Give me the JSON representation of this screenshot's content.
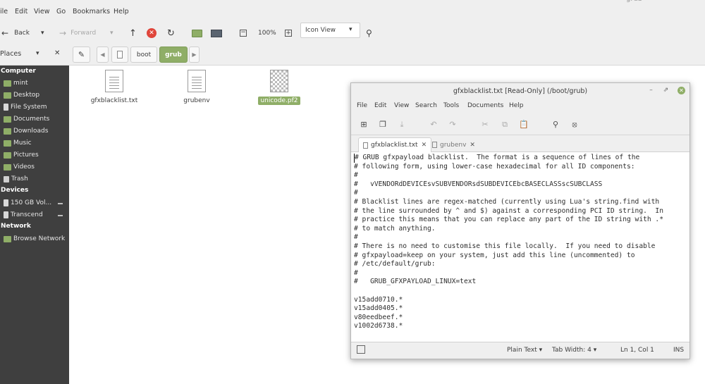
{
  "file_manager": {
    "ghost_title": "grub",
    "menu": [
      "ile",
      "Edit",
      "View",
      "Go",
      "Bookmarks",
      "Help"
    ],
    "toolbar": {
      "back": "Back",
      "forward": "Forward",
      "zoom": "100%",
      "view_mode": "Icon View"
    },
    "sidebar_mode": "Places",
    "breadcrumbs": [
      "boot",
      "grub"
    ],
    "sidebar": {
      "computer_heading": "Computer",
      "computer_items": [
        "mint",
        "Desktop",
        "File System",
        "Documents",
        "Downloads",
        "Music",
        "Pictures",
        "Videos",
        "Trash"
      ],
      "devices_heading": "Devices",
      "devices_items": [
        "150 GB Vol...",
        "Transcend"
      ],
      "network_heading": "Network",
      "network_items": [
        "Browse Network"
      ]
    },
    "files": [
      {
        "name": "gfxblacklist.txt",
        "selected": false
      },
      {
        "name": "grubenv",
        "selected": false
      },
      {
        "name": "unicode.pf2",
        "selected": true
      }
    ]
  },
  "editor": {
    "title": "gfxblacklist.txt [Read-Only] (/boot/grub)",
    "menu": [
      "File",
      "Edit",
      "View",
      "Search",
      "Tools",
      "Documents",
      "Help"
    ],
    "tabs": [
      {
        "label": "gfxblacklist.txt",
        "active": true
      },
      {
        "label": "grubenv",
        "active": false
      }
    ],
    "lines": [
      "# GRUB gfxpayload blacklist.  The format is a sequence of lines of the",
      "# following form, using lower-case hexadecimal for all ID components:",
      "#",
      "#   vVENDORdDEVICEsvSUBVENDORsdSUBDEVICEbcBASECLASSscSUBCLASS",
      "#",
      "# Blacklist lines are regex-matched (currently using Lua's string.find with",
      "# the line surrounded by ^ and $) against a corresponding PCI ID string.  In",
      "# practice this means that you can replace any part of the ID string with .*",
      "# to match anything.",
      "#",
      "# There is no need to customise this file locally.  If you need to disable",
      "# gfxpayload=keep on your system, just add this line (uncommented) to",
      "# /etc/default/grub:",
      "#",
      "#   GRUB_GFXPAYLOAD_LINUX=text",
      "",
      "v15add0710.*",
      "v15add0405.*",
      "v80eedbeef.*",
      "v1002d6738.*"
    ],
    "status": {
      "language": "Plain Text",
      "tab_width": "Tab Width: 4",
      "position": "Ln 1, Col 1",
      "mode": "INS"
    }
  },
  "colors": {
    "accent": "#8fae67",
    "sidebar_bg": "#3f3f3f",
    "close_red": "#e0463b"
  },
  "icons": [
    "back-arrow-icon",
    "forward-arrow-icon",
    "up-arrow-icon",
    "stop-icon",
    "reload-icon",
    "folder-icon",
    "computer-icon",
    "zoom-out-icon",
    "zoom-in-icon",
    "search-icon",
    "edit-pencil-icon",
    "close-icon"
  ]
}
